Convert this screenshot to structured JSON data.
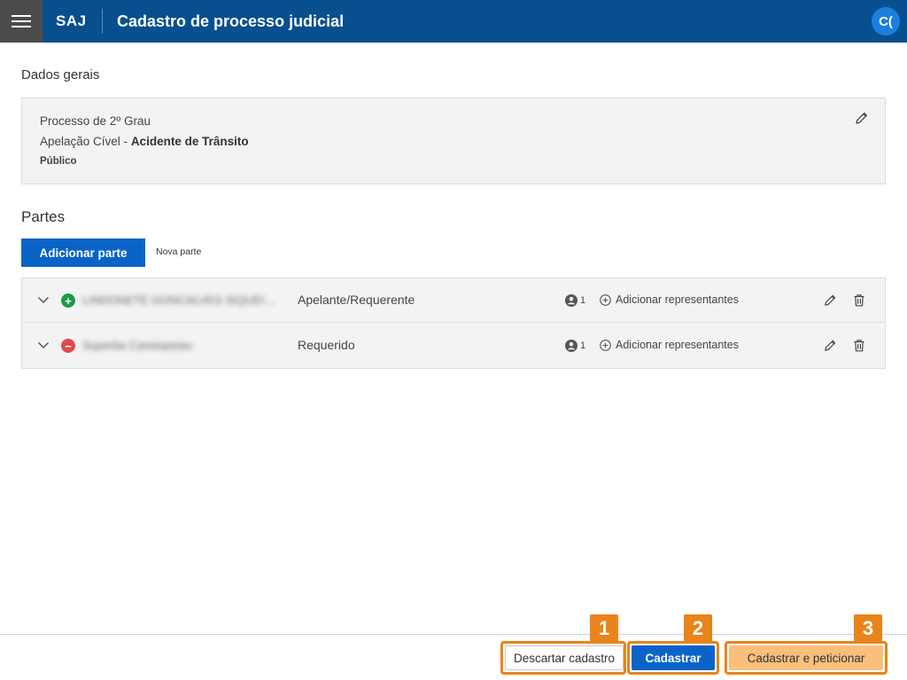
{
  "header": {
    "brand": "SAJ",
    "title": "Cadastro de processo judicial",
    "avatar_initials": "C("
  },
  "dados_gerais": {
    "heading": "Dados gerais",
    "line1": "Processo de 2º Grau",
    "line2_prefix": "Apelação Cível - ",
    "line2_bold": "Acidente de Trânsito",
    "line3": "Público"
  },
  "partes": {
    "heading": "Partes",
    "add_button": "Adicionar parte",
    "nova_parte": "Nova parte",
    "rows": [
      {
        "name": "LINDONETE GONCALVES SIQUEI...",
        "status": "plus",
        "role": "Apelante/Requerente",
        "representantes_count": "1",
        "add_rep_label": "Adicionar representantes"
      },
      {
        "name": "Superba Cassiopeias",
        "status": "minus",
        "role": "Requerido",
        "representantes_count": "1",
        "add_rep_label": "Adicionar representantes"
      }
    ]
  },
  "footer": {
    "discard": "Descartar cadastro",
    "cadastrar": "Cadastrar",
    "cadastrar_peticionar": "Cadastrar e peticionar"
  },
  "callouts": [
    "1",
    "2",
    "3"
  ],
  "colors": {
    "header_bg": "#074f8e",
    "primary": "#0a64c8",
    "callout": "#e8841b",
    "secondary_highlight": "#fbbf7c",
    "status_positive": "#1d9a4a",
    "status_negative": "#e24a4a"
  }
}
